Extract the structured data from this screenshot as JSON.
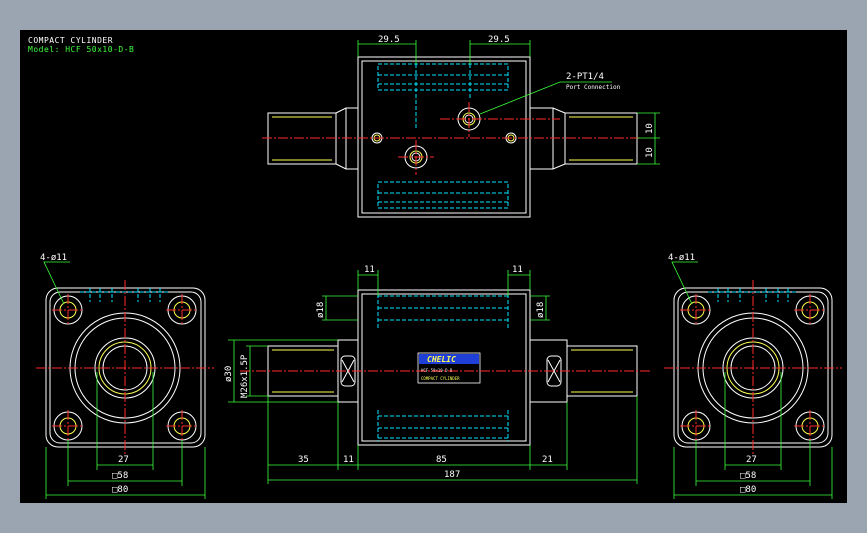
{
  "header": {
    "title": "COMPACT CYLINDER",
    "model": "Model: HCF 50x10-D-B"
  },
  "colors": {
    "background": "#000000",
    "frame": "#9ba5b2",
    "outline": "#ffffff",
    "hidden": "#00e5ff",
    "centerline": "#ff2a2a",
    "dimension": "#3cff3c",
    "thread": "#ffff55",
    "nameplate": "#1f3fd6"
  },
  "labels": {
    "top_dim_left": "29.5",
    "top_dim_right": "29.5",
    "port_callout": "2-PT1/4",
    "port_note": "Port Connection",
    "top_right_10a": "10",
    "top_right_10b": "10",
    "flange_holes_left": "4-ø11",
    "flange_holes_right": "4-ø11",
    "front_11_left": "11",
    "front_11_right": "11",
    "front_d18_left": "ø18",
    "front_d18_right": "ø18",
    "front_d30": "ø30",
    "front_thread": "M26x1.5P",
    "dim_35": "35",
    "dim_11": "11",
    "dim_85": "85",
    "dim_21": "21",
    "dim_187": "187",
    "left_27": "27",
    "left_58": "□58",
    "left_80": "□80",
    "right_27": "27",
    "right_58": "□58",
    "right_80": "□80"
  },
  "nameplate": {
    "brand": "CHELIC",
    "model": "HCF 50x10-D-B",
    "name": "COMPACT CYLINDER"
  }
}
